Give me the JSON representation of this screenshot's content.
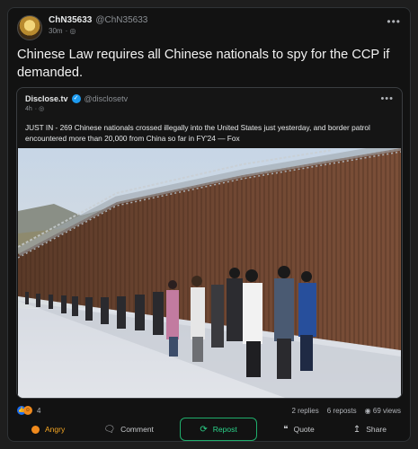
{
  "post": {
    "name": "ChN35633",
    "handle": "@ChN35633",
    "time": "30m",
    "globe_glyph": "· ◎",
    "text": "Chinese Law requires all Chinese nationals to spy for the CCP if demanded."
  },
  "quote": {
    "name": "Disclose.tv",
    "verified_glyph": "✓",
    "handle": "@disclosetv",
    "time": "4h",
    "globe_glyph": "· ◎",
    "text": "JUST IN - 269 Chinese nationals crossed illegally into the United States just yesterday, and border patrol encountered more than 20,000 from China so far in FY'24 — Fox"
  },
  "stats": {
    "reaction_count": "4",
    "replies": "2 replies",
    "reposts": "6 reposts",
    "views": "69 views"
  },
  "actions": {
    "angry": "Angry",
    "comment": "Comment",
    "repost": "Repost",
    "quote": "Quote",
    "share": "Share"
  },
  "icons": {
    "more": "more-options-icon",
    "globe": "globe-icon",
    "verified": "verified-badge-icon",
    "comment": "comment-icon",
    "repost": "repost-icon",
    "quote": "quote-icon",
    "share": "share-icon",
    "views": "eye-icon"
  },
  "colors": {
    "background": "#121212",
    "accent_repost": "#2bd38a",
    "angry": "#f5a623",
    "verified": "#1d9bf0"
  }
}
